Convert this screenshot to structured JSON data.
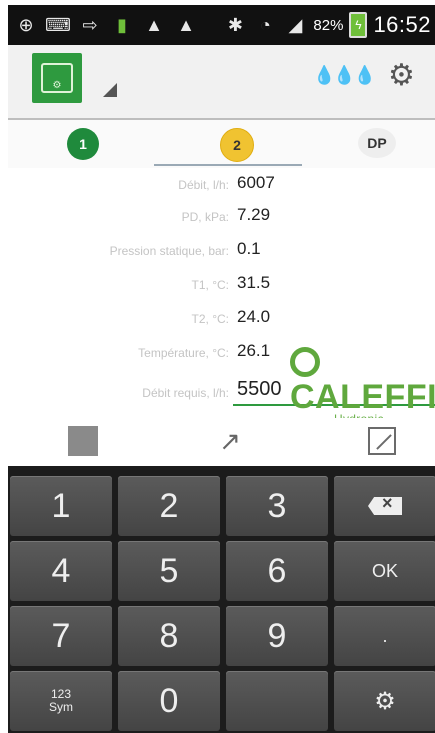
{
  "statusbar": {
    "battery_pct": "82%",
    "time": "16:52"
  },
  "tabs": [
    {
      "label": "1"
    },
    {
      "label": "2"
    },
    {
      "label": "DP"
    }
  ],
  "form": {
    "fields": [
      {
        "label": "Débit, l/h:",
        "value": "6007"
      },
      {
        "label": "PD, kPa:",
        "value": "7.29"
      },
      {
        "label": "Pression statique, bar:",
        "value": "0.1"
      },
      {
        "label": "T1, °C:",
        "value": "31.5"
      },
      {
        "label": "T2, °C:",
        "value": "24.0"
      },
      {
        "label": "Température, °C:",
        "value": "26.1"
      },
      {
        "label": "Débit requis, l/h:",
        "value": "5500"
      }
    ]
  },
  "brand": {
    "name": "CALEFFI",
    "tagline": "Hydronic Solutions"
  },
  "keyboard": {
    "rows": [
      [
        "1",
        "2",
        "3",
        "⌫"
      ],
      [
        "4",
        "5",
        "6",
        "OK"
      ],
      [
        "7",
        "8",
        "9",
        "."
      ],
      [
        "123 Sym",
        "0",
        "",
        "⚙"
      ]
    ],
    "sym_top": "123",
    "sym_bottom": "Sym"
  },
  "colors": {
    "brand_green": "#2e9a3f",
    "tab2_yellow": "#f0c331"
  }
}
